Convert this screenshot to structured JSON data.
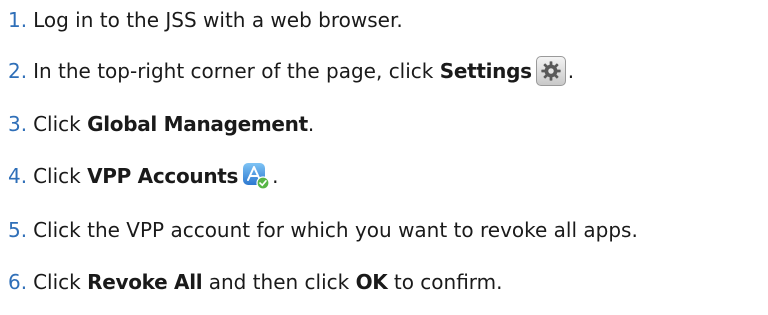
{
  "steps": [
    {
      "num": "1.",
      "parts": [
        {
          "text": "Log in to the JSS with a web browser.",
          "bold": false
        }
      ]
    },
    {
      "num": "2.",
      "parts": [
        {
          "text": "In the top-right corner of the page, click ",
          "bold": false
        },
        {
          "text": "Settings",
          "bold": true
        },
        {
          "icon": "gear-icon"
        },
        {
          "text": ".",
          "bold": false
        }
      ]
    },
    {
      "num": "3.",
      "parts": [
        {
          "text": "Click ",
          "bold": false
        },
        {
          "text": "Global Management",
          "bold": true
        },
        {
          "text": ".",
          "bold": false
        }
      ]
    },
    {
      "num": "4.",
      "parts": [
        {
          "text": "Click ",
          "bold": false
        },
        {
          "text": "VPP Accounts",
          "bold": true
        },
        {
          "icon": "vpp-accounts-icon"
        },
        {
          "text": ".",
          "bold": false
        }
      ]
    },
    {
      "num": "5.",
      "parts": [
        {
          "text": "Click the VPP account for which you want to revoke all apps.",
          "bold": false
        }
      ]
    },
    {
      "num": "6.",
      "parts": [
        {
          "text": "Click ",
          "bold": false
        },
        {
          "text": "Revoke All",
          "bold": true
        },
        {
          "text": " and then click ",
          "bold": false
        },
        {
          "text": "OK",
          "bold": true
        },
        {
          "text": " to confirm.",
          "bold": false
        }
      ]
    }
  ],
  "colors": {
    "step_number": "#2f6fb8",
    "text": "#1a1a1a"
  }
}
